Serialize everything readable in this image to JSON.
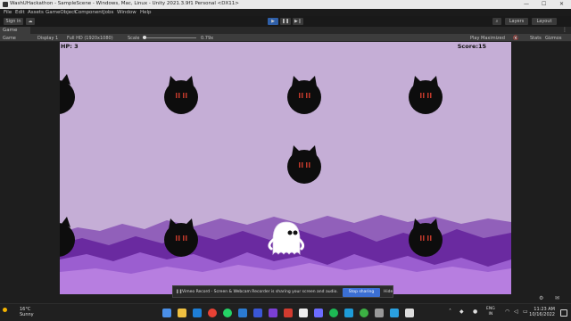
{
  "window": {
    "title": "WashUHackathon - SampleScene - Windows, Mac, Linux - Unity 2021.3.9f1 Personal <DX11>",
    "controls": [
      "—",
      "☐",
      "✕"
    ]
  },
  "menu": [
    "File",
    "Edit",
    "Assets",
    "GameObject",
    "Component",
    "Jobs",
    "Window",
    "Help"
  ],
  "toolbar": {
    "sign_in": "Sign in",
    "layers": "Layers",
    "layout": "Layout"
  },
  "game_tab": {
    "label": "Game"
  },
  "game_controls": {
    "view_mode": "Game",
    "display": "Display 1",
    "resolution": "Full HD (1920x1080)",
    "scale_label": "Scale",
    "scale_value": "0.79x",
    "play_mode": "Play Maximized",
    "stats": "Stats",
    "gizmos": "Gizmos"
  },
  "game": {
    "hp": "HP: 3",
    "score": "Score:15",
    "sky_color": "#c5aed6",
    "enemy_color": "#0d0d0d",
    "enemy_eye_color": "#c0392b"
  },
  "notification": {
    "message": "Vimeo Record - Screen & Webcam Recorder is sharing your screen and audio.",
    "stop_sharing": "Stop sharing",
    "hide": "Hide"
  },
  "taskbar": {
    "temperature": "16°C",
    "weather": "Sunny",
    "language": "ENG",
    "region": "IN",
    "time": "11:23 AM",
    "date": "10/16/2022"
  }
}
